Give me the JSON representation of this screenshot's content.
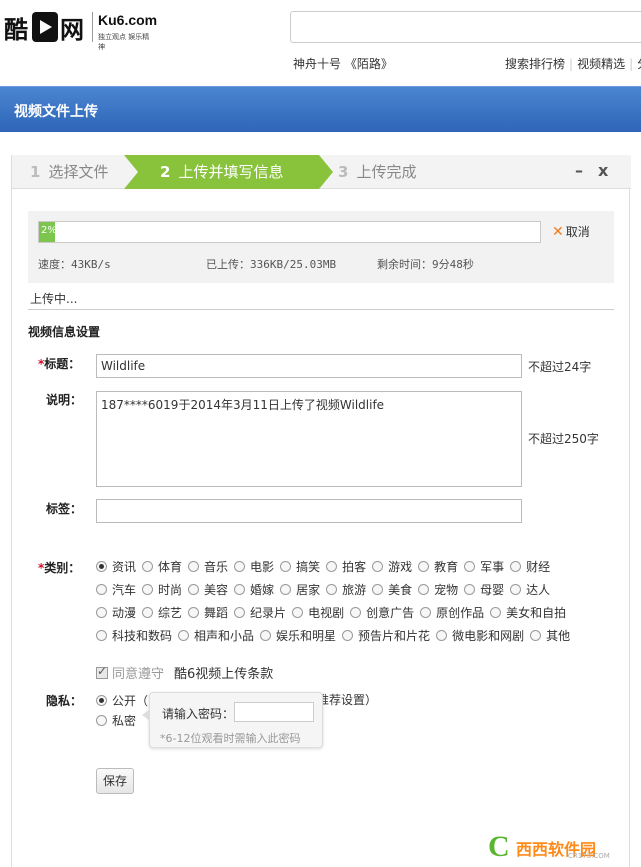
{
  "header": {
    "logo_text_1": "酷",
    "logo_text_2": "网",
    "site_name": "Ku6.com",
    "slogan": "独立观点 娱乐精神",
    "hot_keywords": "神舟十号 《陌路》",
    "links": [
      "搜索排行榜",
      "视频精选",
      "分"
    ]
  },
  "titlebar": {
    "title": "视频文件上传"
  },
  "steps": [
    {
      "num": "1",
      "label": "选择文件"
    },
    {
      "num": "2",
      "label": "上传并填写信息"
    },
    {
      "num": "3",
      "label": "上传完成"
    }
  ],
  "window_controls": {
    "minimize": "–",
    "close": "x"
  },
  "upload": {
    "progress": 2,
    "progress_text": "2%",
    "cancel_label": "取消",
    "speed": "速度：43KB/s",
    "uploaded": "已上传：336KB/25.03MB",
    "remaining": "剩余时间：9分48秒",
    "status": "上传中..."
  },
  "form": {
    "section_title": "视频信息设置",
    "title_label": "标题：",
    "title_value": "Wildlife",
    "title_hint": "不超过24字",
    "desc_label": "说明：",
    "desc_value": "187****6019于2014年3月11日上传了视频Wildlife",
    "desc_hint": "不超过250字",
    "tags_label": "标签：",
    "tags_value": "",
    "category_label": "类别：",
    "category_rows": [
      [
        "资讯",
        "体育",
        "音乐",
        "电影",
        "搞笑",
        "拍客",
        "游戏",
        "教育",
        "军事",
        "财经"
      ],
      [
        "汽车",
        "时尚",
        "美容",
        "婚嫁",
        "居家",
        "旅游",
        "美食",
        "宠物",
        "母婴",
        "达人"
      ],
      [
        "动漫",
        "综艺",
        "舞蹈",
        "纪录片",
        "电视剧",
        "创意广告",
        "原创作品",
        "美女和自拍"
      ],
      [
        "科技和数码",
        "相声和小品",
        "娱乐和明星",
        "预告片和片花",
        "微电影和网剧",
        "其他"
      ]
    ],
    "selected_category": "资讯",
    "agree_label": "同意遵守",
    "terms_label": "酷6视频上传条款",
    "privacy_label": "隐私：",
    "privacy_public": "公开（",
    "privacy_public_tail": "推荐设置）",
    "privacy_private": "私密",
    "password_label": "请输入密码：",
    "password_hint": "*6-12位观看时需输入此密码",
    "save_label": "保存"
  },
  "watermark": {
    "text": "西西软件园",
    "url": "CR173.COM"
  },
  "colors": {
    "title_blue": "#2f65b8",
    "step_green": "#89c33b",
    "required_red": "#d0102d",
    "cancel_orange": "#f07b1b"
  }
}
